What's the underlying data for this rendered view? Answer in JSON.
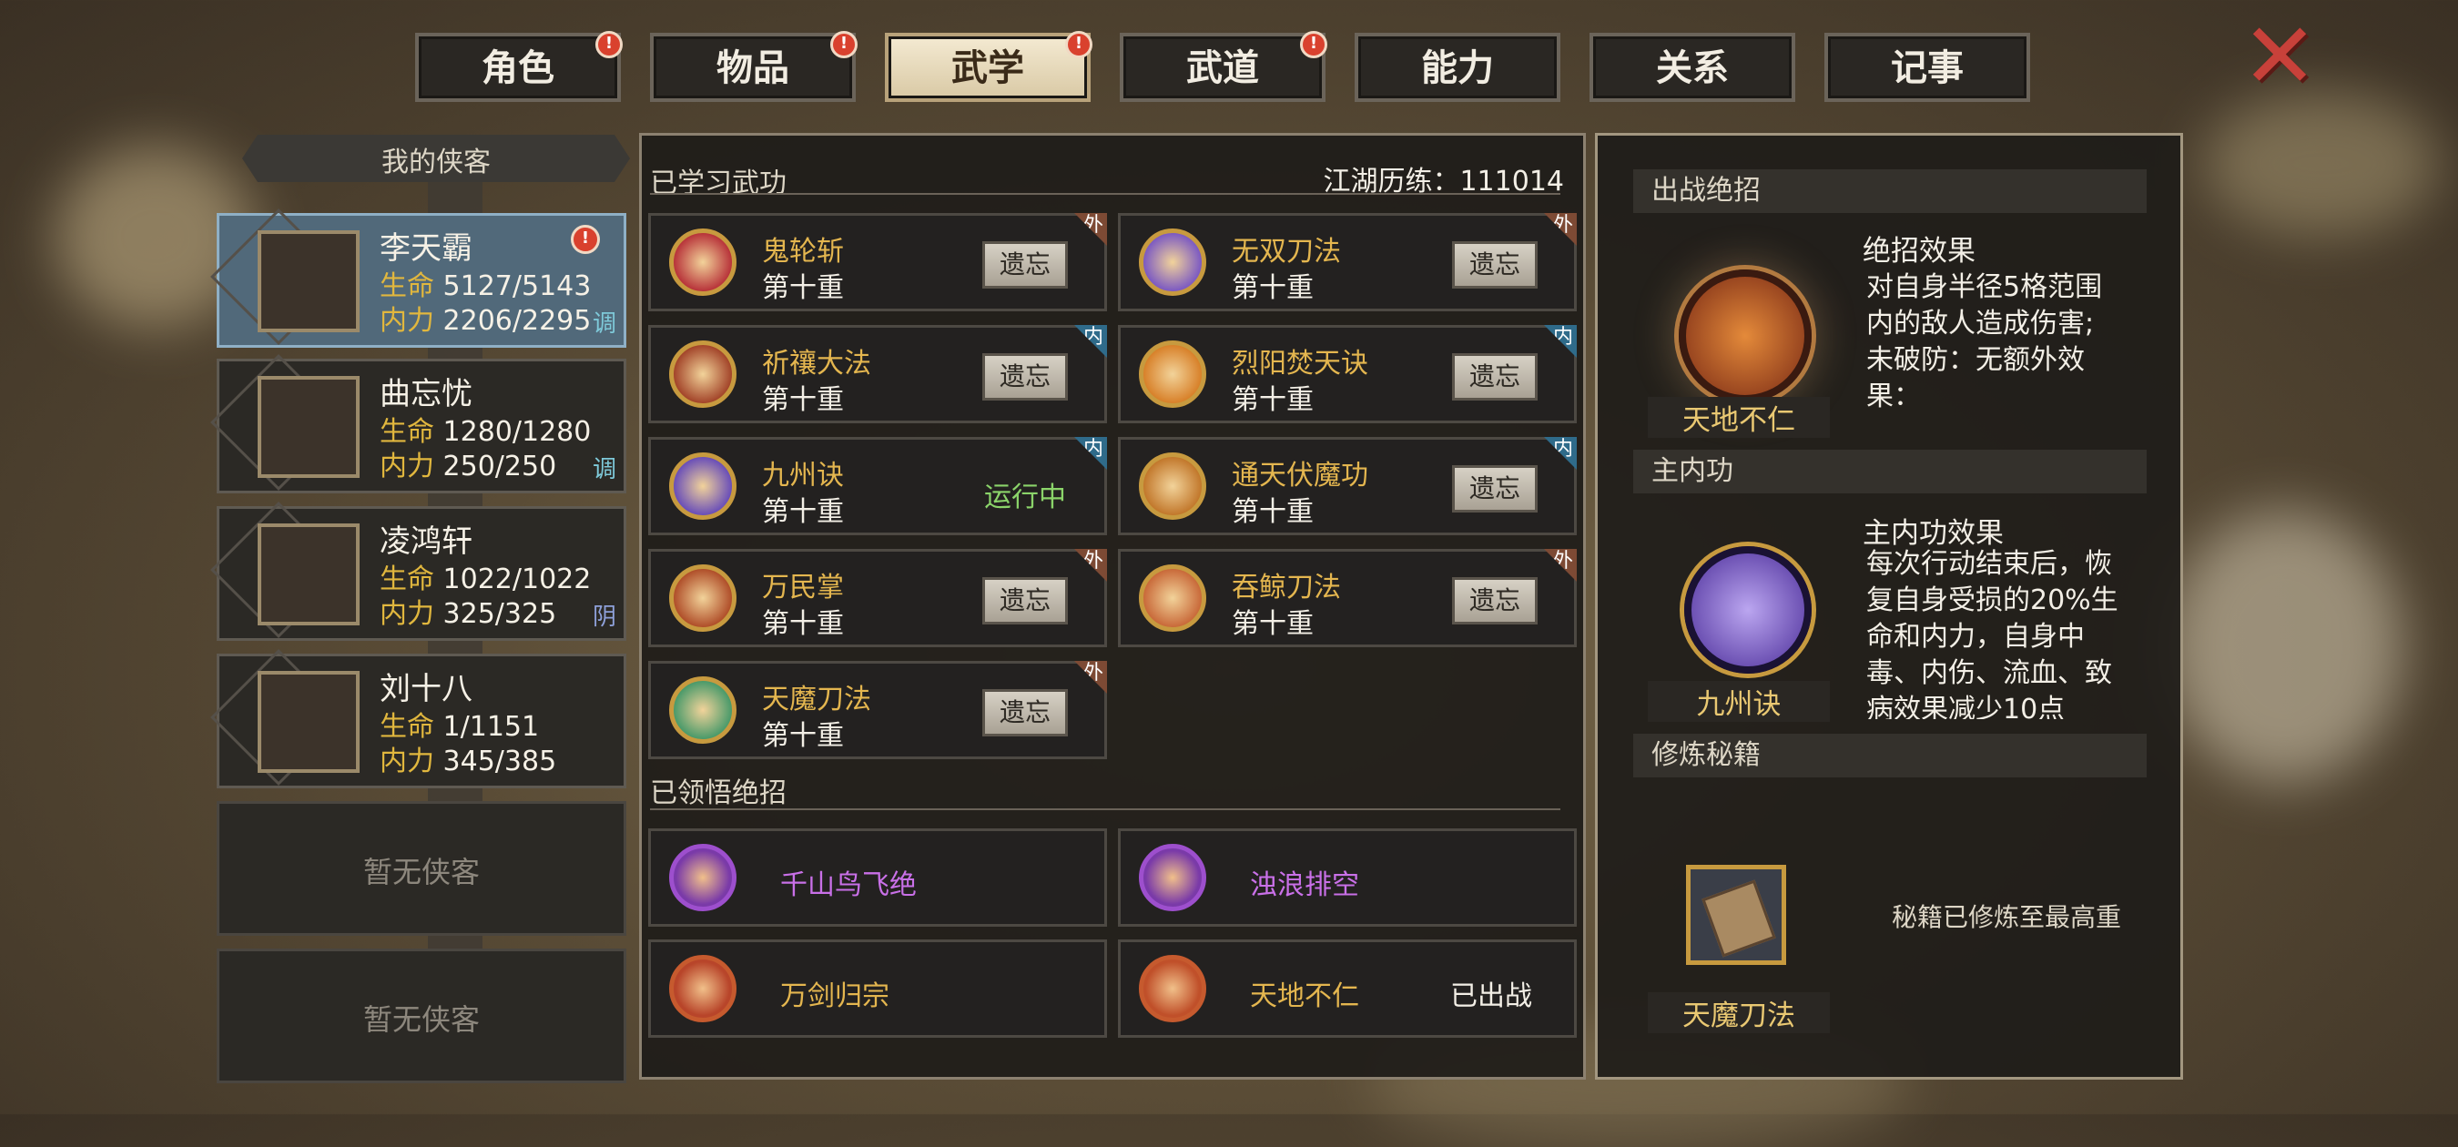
{
  "tabs": [
    {
      "label": "角色",
      "alert": "!"
    },
    {
      "label": "物品",
      "alert": "!"
    },
    {
      "label": "武学",
      "alert": "!",
      "active": true
    },
    {
      "label": "武道",
      "alert": "!"
    },
    {
      "label": "能力",
      "alert": ""
    },
    {
      "label": "关系",
      "alert": ""
    },
    {
      "label": "记事",
      "alert": ""
    }
  ],
  "close_icon": "close-x-icon",
  "sidebar": {
    "title": "我的侠客",
    "heroes": [
      {
        "name": "李天霸",
        "life_label": "生命",
        "life": "5127/5143",
        "mp_label": "内力",
        "mp": "2206/2295",
        "tag": "调",
        "tag_color": "#7ec9d9",
        "alert": "!",
        "selected": true
      },
      {
        "name": "曲忘忧",
        "life_label": "生命",
        "life": "1280/1280",
        "mp_label": "内力",
        "mp": "250/250",
        "tag": "调",
        "tag_color": "#7ec9d9"
      },
      {
        "name": "凌鸿轩",
        "life_label": "生命",
        "life": "1022/1022",
        "mp_label": "内力",
        "mp": "325/325",
        "tag": "阴",
        "tag_color": "#8ea0d9"
      },
      {
        "name": "刘十八",
        "life_label": "生命",
        "life": "1/1151",
        "mp_label": "内力",
        "mp": "345/385",
        "tag": ""
      }
    ],
    "empty_slots": [
      "暂无侠客",
      "暂无侠客"
    ]
  },
  "middle": {
    "learned_title": "已学习武功",
    "experience_label": "江湖历练：111014",
    "forget_label": "遗忘",
    "running_label": "运行中",
    "skills": [
      {
        "name": "鬼轮斩",
        "level": "第十重",
        "type": "外",
        "action": "forget",
        "icon_color": "#b8343a"
      },
      {
        "name": "无双刀法",
        "level": "第十重",
        "type": "外",
        "action": "forget",
        "icon_color": "#7c5ac2"
      },
      {
        "name": "祈禳大法",
        "level": "第十重",
        "type": "内",
        "action": "forget",
        "icon_color": "#a3452a"
      },
      {
        "name": "烈阳焚天诀",
        "level": "第十重",
        "type": "内",
        "action": "forget",
        "icon_color": "#d8812a"
      },
      {
        "name": "九州诀",
        "level": "第十重",
        "type": "内",
        "action": "running",
        "icon_color": "#6a4fb8"
      },
      {
        "name": "通天伏魔功",
        "level": "第十重",
        "type": "内",
        "action": "forget",
        "icon_color": "#c2782c"
      },
      {
        "name": "万民掌",
        "level": "第十重",
        "type": "外",
        "action": "forget",
        "icon_color": "#b04f2a"
      },
      {
        "name": "吞鲸刀法",
        "level": "第十重",
        "type": "外",
        "action": "forget",
        "icon_color": "#c96a3a"
      },
      {
        "name": "天魔刀法",
        "level": "第十重",
        "type": "外",
        "action": "forget",
        "icon_color": "#4a9a6a"
      }
    ],
    "ult_title": "已领悟绝招",
    "ultimates": [
      {
        "name": "千山鸟飞绝",
        "color": "#c970e8",
        "icon_color": "#7a3aa8",
        "status": ""
      },
      {
        "name": "浊浪排空",
        "color": "#c970e8",
        "icon_color": "#7a3aa8",
        "status": ""
      },
      {
        "name": "万剑归宗",
        "color": "#e4b64f",
        "icon_color": "#b8452a",
        "status": ""
      },
      {
        "name": "天地不仁",
        "color": "#e4b64f",
        "icon_color": "#c0502a",
        "status": "已出战"
      }
    ]
  },
  "right": {
    "battle_title": "出战绝招",
    "battle_skill": "天地不仁",
    "battle_effect_title": "绝招效果",
    "battle_effect": [
      "对自身半径5格范围",
      "内的敌人造成伤害;",
      "未破防：无额外效",
      "果："
    ],
    "main_title": "主内功",
    "main_skill": "九州诀",
    "main_effect_title": "主内功效果",
    "main_effect": [
      "每次行动结束后，恢",
      "复自身受损的20%生",
      "命和内力，自身中",
      "毒、内伤、流血、致",
      "病效果减少10点"
    ],
    "cult_title": "修炼秘籍",
    "cult_skill": "天魔刀法",
    "cult_status": "秘籍已修炼至最高重"
  }
}
